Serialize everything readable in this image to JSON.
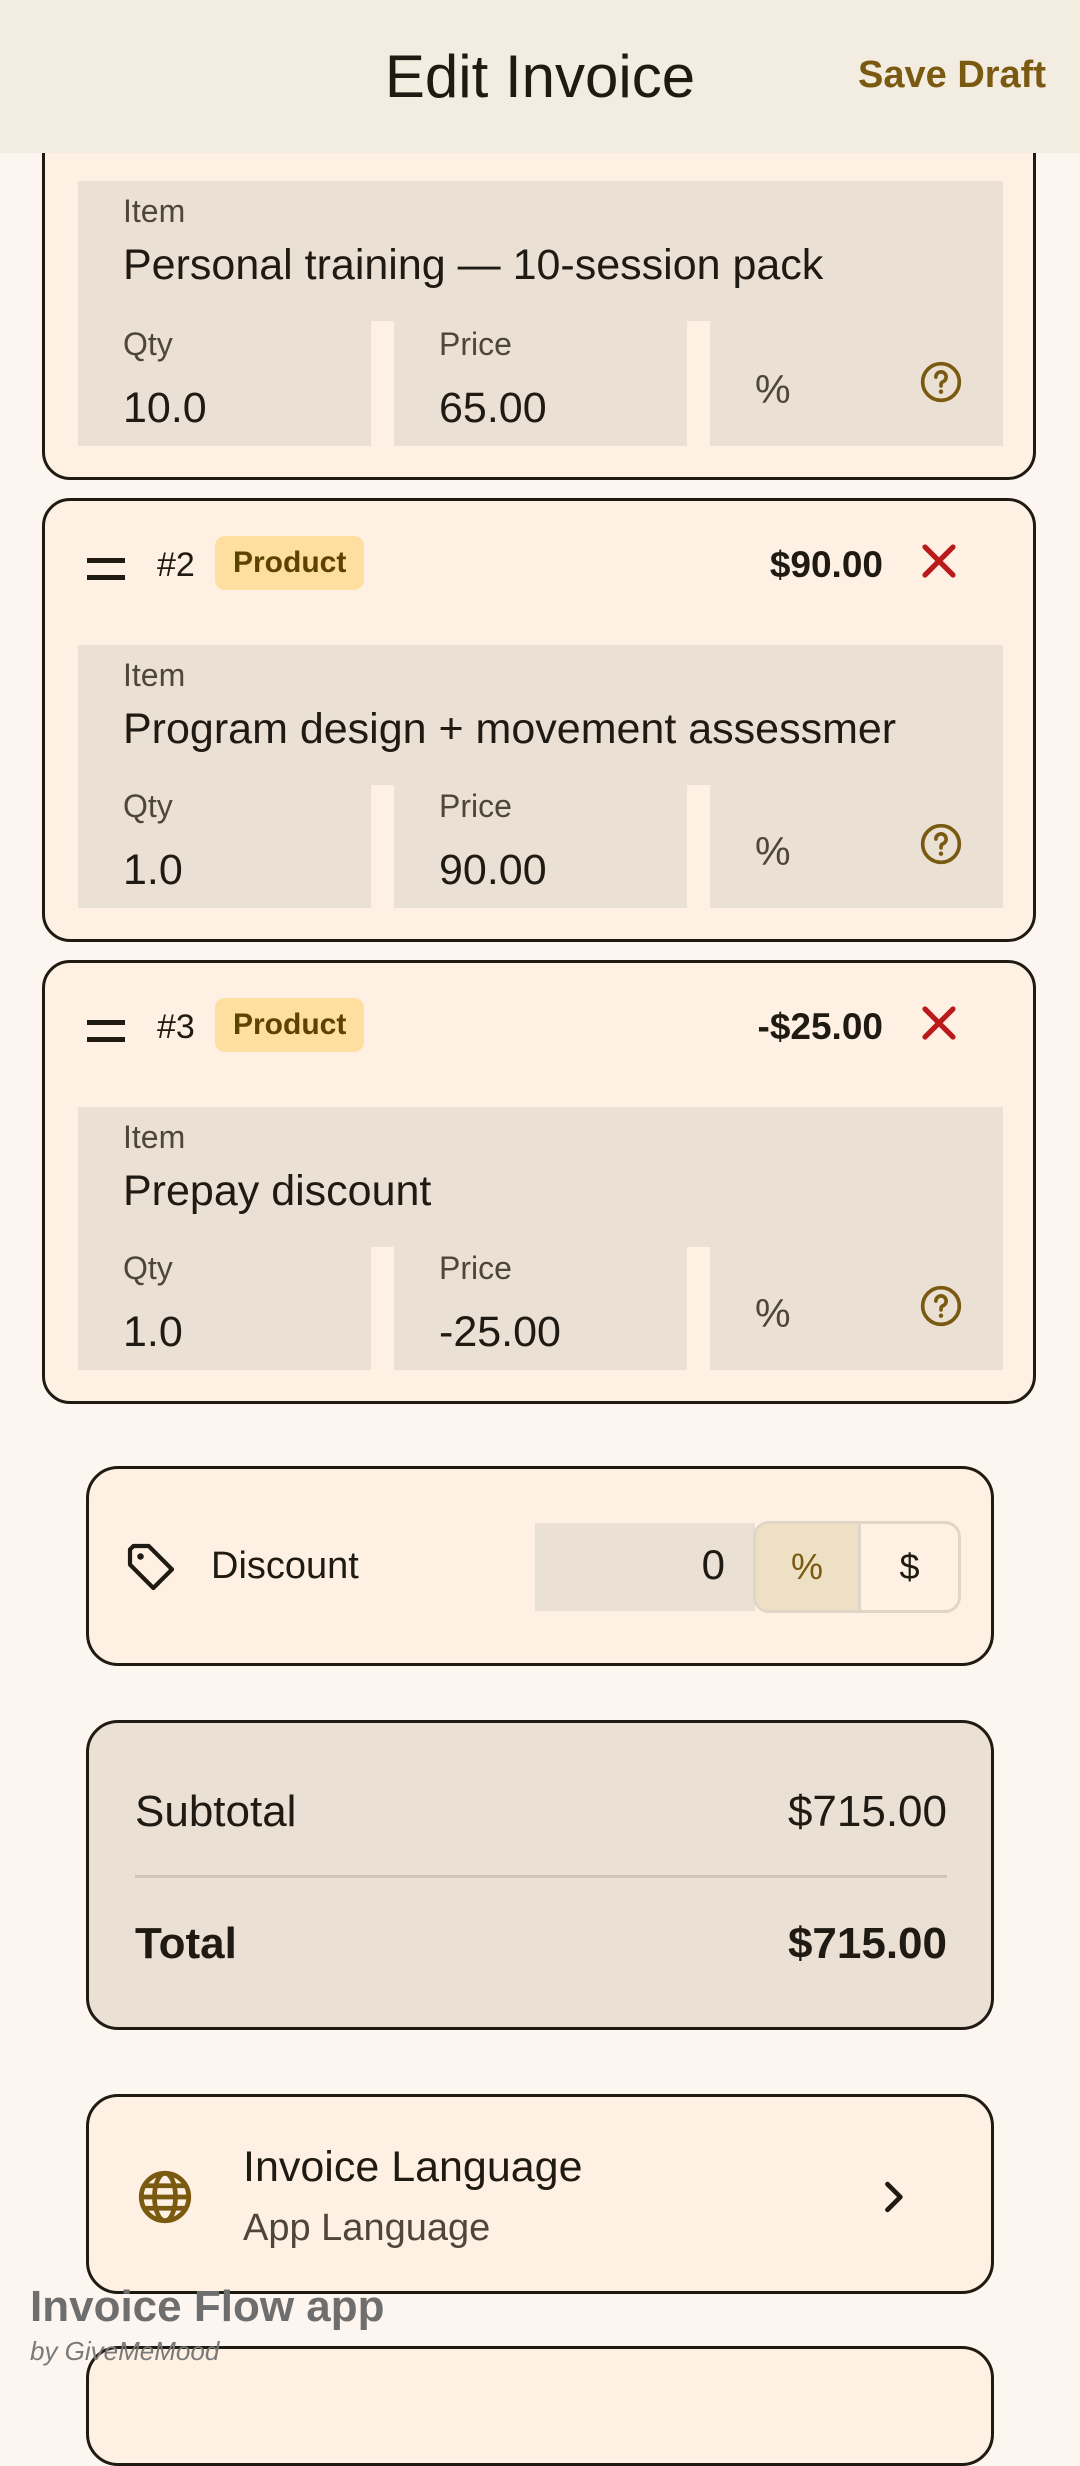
{
  "header": {
    "title": "Edit Invoice",
    "save_label": "Save Draft"
  },
  "labels": {
    "item": "Item",
    "qty": "Qty",
    "price": "Price",
    "percent": "%"
  },
  "items": [
    {
      "name": "Personal training — 10-session pack",
      "qty": "10.0",
      "price": "65.00"
    },
    {
      "index": "#2",
      "type": "Product",
      "amount": "$90.00",
      "name": "Program design + movement assessmer",
      "qty": "1.0",
      "price": "90.00"
    },
    {
      "index": "#3",
      "type": "Product",
      "amount": "-$25.00",
      "name": "Prepay discount",
      "qty": "1.0",
      "price": "-25.00"
    }
  ],
  "discount": {
    "label": "Discount",
    "value": "0",
    "percent_option": "%",
    "dollar_option": "$",
    "selected": "%"
  },
  "totals": {
    "subtotal_label": "Subtotal",
    "subtotal_value": "$715.00",
    "total_label": "Total",
    "total_value": "$715.00"
  },
  "language": {
    "title": "Invoice Language",
    "subtitle": "App Language"
  },
  "watermark": {
    "app": "Invoice Flow app",
    "by": "by GiveMeMood"
  },
  "icons": {
    "drag": "drag-handle-icon",
    "remove": "close-icon",
    "help": "help-circle-icon",
    "tag": "tag-icon",
    "globe": "globe-icon",
    "chevron": "chevron-right-icon"
  },
  "colors": {
    "accent": "#7A5A10",
    "remove": "#BA1A1A",
    "badge_bg": "#FEDFA0",
    "card_bg": "#FEF1E4",
    "field_bg": "#EAE0D4"
  }
}
